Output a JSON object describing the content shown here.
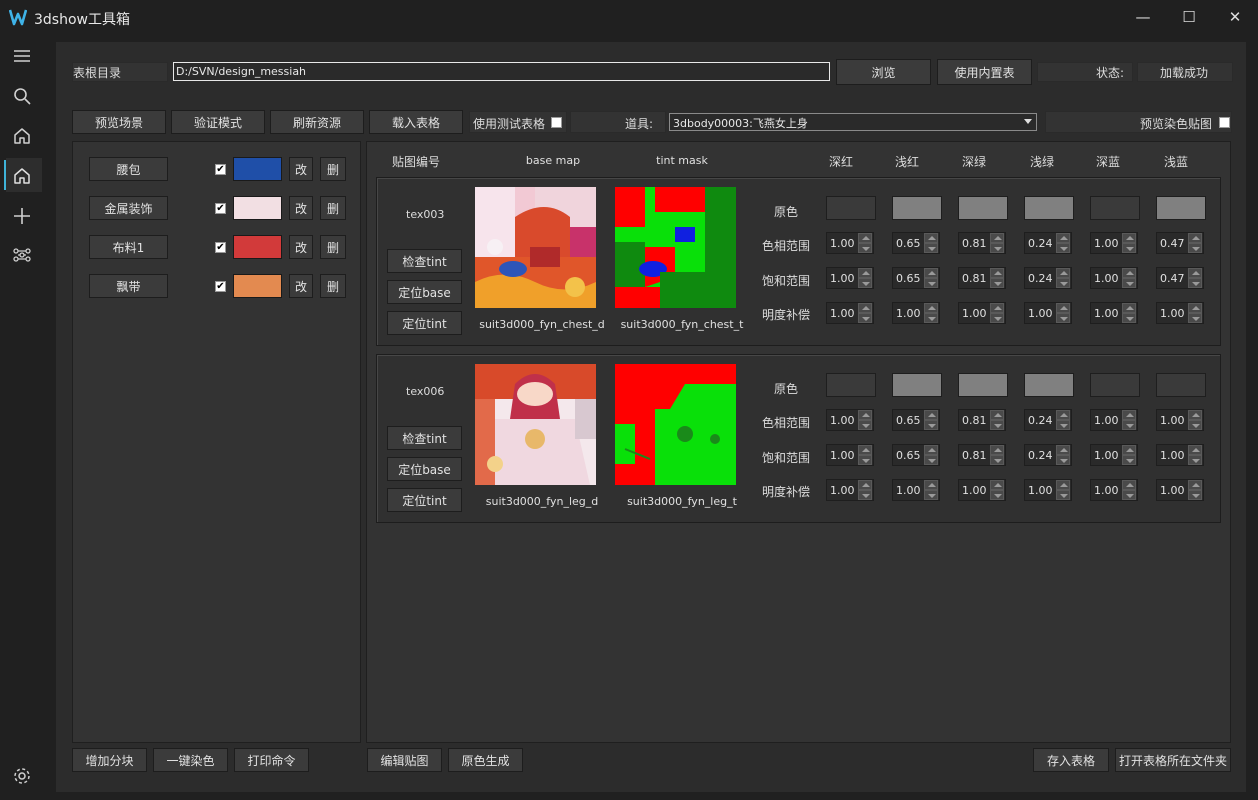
{
  "window": {
    "title": "3dshow工具箱",
    "min": "—",
    "max": "☐",
    "close": "✕"
  },
  "rail": {
    "icons": [
      "menu-icon",
      "search-icon",
      "home-icon",
      "home-active-icon",
      "plus-icon",
      "graph-icon",
      "settings-icon"
    ]
  },
  "top": {
    "root_label": "表根目录",
    "root_value": "D:/SVN/design_messiah",
    "browse": "浏览",
    "use_builtin": "使用内置表",
    "status_label": "状态:",
    "status_value": "加载成功"
  },
  "toolbar": {
    "preview_scene": "预览场景",
    "verify_mode": "验证模式",
    "refresh": "刷新资源",
    "load_table": "载入表格",
    "use_test_table": "使用测试表格",
    "item_label": "道具:",
    "item_value": "3dbody00003:飞燕女上身",
    "preview_dye": "预览染色贴图"
  },
  "blocks": [
    {
      "name": "腰包",
      "checked": true,
      "color": "#1f4fa8",
      "edit": "改",
      "del": "删"
    },
    {
      "name": "金属装饰",
      "checked": true,
      "color": "#f2dfe3",
      "edit": "改",
      "del": "删"
    },
    {
      "name": "布料1",
      "checked": true,
      "color": "#d23a3a",
      "edit": "改",
      "del": "删"
    },
    {
      "name": "飘带",
      "checked": true,
      "color": "#e38a50",
      "edit": "改",
      "del": "删"
    }
  ],
  "left_bottom": {
    "add_block": "增加分块",
    "one_dye": "一键染色",
    "print_cmd": "打印命令"
  },
  "columns": {
    "tex_id": "贴图编号",
    "base_map": "base map",
    "tint_mask": "tint mask",
    "c1": "深红",
    "c2": "浅红",
    "c3": "深绿",
    "c4": "浅绿",
    "c5": "深蓝",
    "c6": "浅蓝"
  },
  "rows_labels": {
    "orig": "原色",
    "hue": "色相范围",
    "sat": "饱和范围",
    "bright": "明度补偿"
  },
  "textures": [
    {
      "id": "tex003",
      "check_tint": "检查tint",
      "locate_base": "定位base",
      "locate_tint": "定位tint",
      "base_name": "suit3d000_fyn_chest_d",
      "tint_name": "suit3d000_fyn_chest_t",
      "orig": [
        "#3a3a3a",
        "#808080",
        "#808080",
        "#808080",
        "#3a3a3a",
        "#808080"
      ],
      "hue": [
        "1.00",
        "0.65",
        "0.81",
        "0.24",
        "1.00",
        "0.47"
      ],
      "sat": [
        "1.00",
        "0.65",
        "0.81",
        "0.24",
        "1.00",
        "0.47"
      ],
      "bright": [
        "1.00",
        "1.00",
        "1.00",
        "1.00",
        "1.00",
        "1.00"
      ]
    },
    {
      "id": "tex006",
      "check_tint": "检查tint",
      "locate_base": "定位base",
      "locate_tint": "定位tint",
      "base_name": "suit3d000_fyn_leg_d",
      "tint_name": "suit3d000_fyn_leg_t",
      "orig": [
        "#3a3a3a",
        "#808080",
        "#808080",
        "#808080",
        "#3a3a3a",
        "#3a3a3a"
      ],
      "hue": [
        "1.00",
        "0.65",
        "0.81",
        "0.24",
        "1.00",
        "1.00"
      ],
      "sat": [
        "1.00",
        "0.65",
        "0.81",
        "0.24",
        "1.00",
        "1.00"
      ],
      "bright": [
        "1.00",
        "1.00",
        "1.00",
        "1.00",
        "1.00",
        "1.00"
      ]
    }
  ],
  "right_bottom": {
    "edit_tex": "编辑贴图",
    "gen_orig": "原色生成",
    "save_table": "存入表格",
    "open_folder": "打开表格所在文件夹"
  }
}
